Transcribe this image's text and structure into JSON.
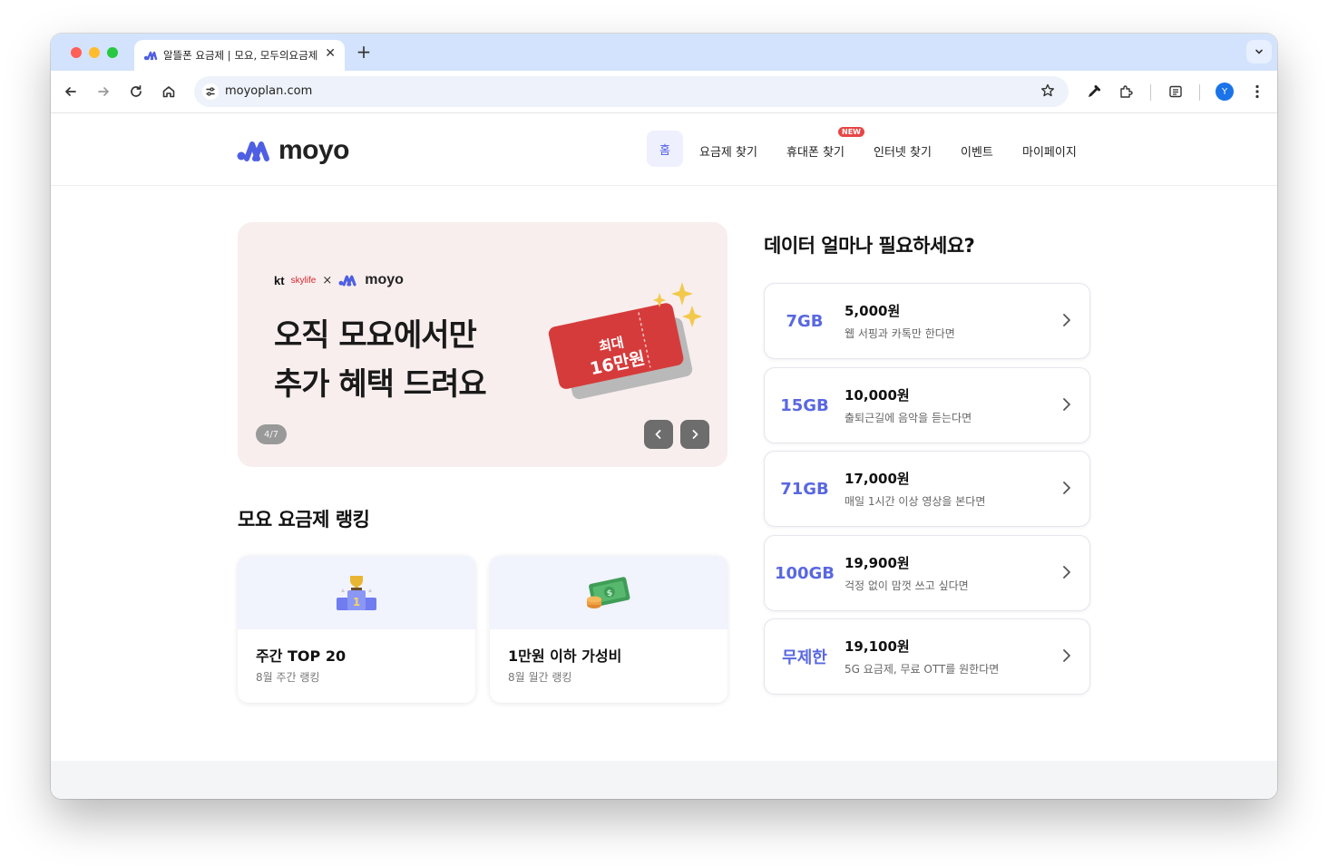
{
  "browser": {
    "tab_title": "알뜰폰 요금제 | 모요, 모두의요금제",
    "close_glyph": "✕",
    "new_tab_glyph": "+",
    "url": "moyoplan.com",
    "profile_initial": "Y"
  },
  "header": {
    "logo_text": "moyo",
    "nav": {
      "home": "홈",
      "plans": "요금제 찾기",
      "phones": "휴대폰 찾기",
      "phones_badge": "NEW",
      "internet": "인터넷 찾기",
      "events": "이벤트",
      "mypage": "마이페이지"
    }
  },
  "banner": {
    "brand_kt": "kt",
    "brand_skylife": "skylife",
    "brand_x": "×",
    "brand_moyo": "moyo",
    "headline_line1": "오직 모요에서만",
    "headline_line2": "추가 혜택 드려요",
    "ticket_line1": "최대",
    "ticket_line2": "16만원",
    "counter": "4/7"
  },
  "ranking": {
    "title": "모요 요금제 랭킹",
    "cards": [
      {
        "title": "주간 TOP 20",
        "subtitle": "8월 주간 랭킹",
        "icon": "trophy-podium-icon"
      },
      {
        "title": "1만원 이하 가성비",
        "subtitle": "8월 월간 랭킹",
        "icon": "money-icon"
      }
    ]
  },
  "data_section": {
    "title": "데이터 얼마나 필요하세요?",
    "options": [
      {
        "amount": "7GB",
        "price": "5,000원",
        "desc": "웹 서핑과 카톡만 한다면"
      },
      {
        "amount": "15GB",
        "price": "10,000원",
        "desc": "출퇴근길에 음악을 듣는다면"
      },
      {
        "amount": "71GB",
        "price": "17,000원",
        "desc": "매일 1시간 이상 영상을 본다면"
      },
      {
        "amount": "100GB",
        "price": "19,900원",
        "desc": "걱정 없이 맘껏 쓰고 싶다면"
      },
      {
        "amount": "무제한",
        "price": "19,100원",
        "desc": "5G 요금제, 무료 OTT를 원한다면"
      }
    ]
  },
  "colors": {
    "brand": "#5461e6",
    "tab_strip": "#d3e3fd",
    "banner_bg": "#f8eeee",
    "ticket_red": "#d63b3b"
  }
}
